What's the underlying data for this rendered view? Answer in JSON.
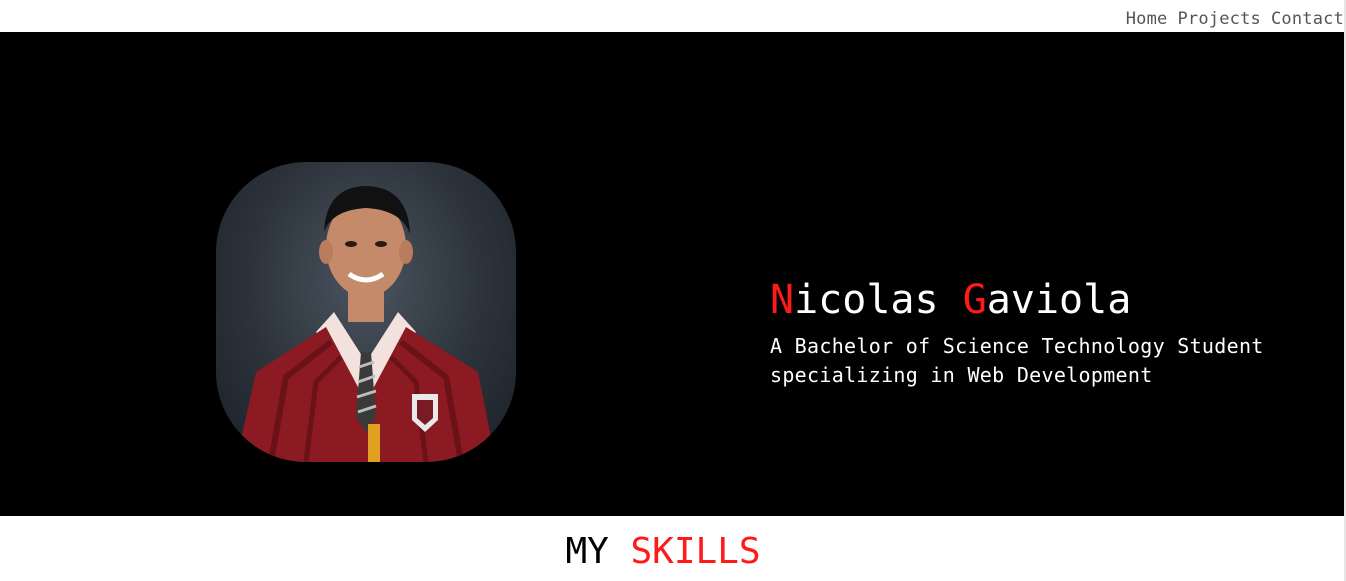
{
  "nav": {
    "items": [
      {
        "label": "Home"
      },
      {
        "label": "Projects"
      },
      {
        "label": "Contact"
      }
    ]
  },
  "hero": {
    "name_first_initial": "N",
    "name_first_rest": "icolas",
    "name_last_initial": "G",
    "name_last_rest": "aviola",
    "subtitle": "A Bachelor of Science Technology Student specializing in Web Development",
    "accent_color": "#ff1a1a",
    "background_color": "#000000"
  },
  "skills": {
    "title_first": "MY",
    "title_accent": "SKILLS"
  }
}
